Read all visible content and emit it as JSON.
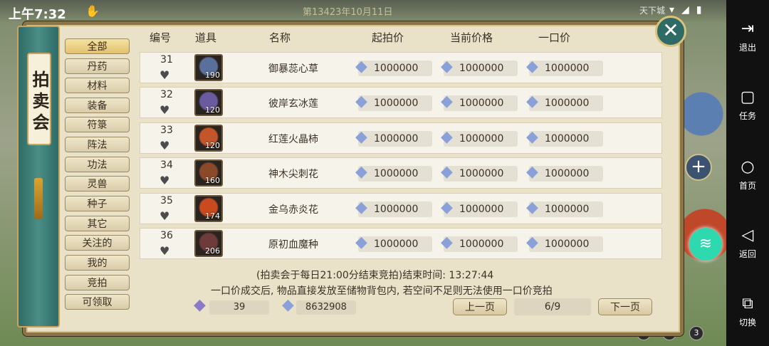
{
  "status": {
    "time": "上午7:32",
    "server_date": "第13423年10月11日",
    "topright": "天下城"
  },
  "sidenav": [
    {
      "icon": "exit-icon",
      "label": "退出"
    },
    {
      "icon": "task-icon",
      "label": "任务"
    },
    {
      "icon": "home-icon",
      "label": "首页"
    },
    {
      "icon": "back-icon",
      "label": "返回"
    },
    {
      "icon": "switch-icon",
      "label": "切换"
    }
  ],
  "panel": {
    "title": "拍卖会"
  },
  "categories": [
    "全部",
    "丹药",
    "材料",
    "装备",
    "符箓",
    "阵法",
    "功法",
    "灵兽",
    "种子",
    "其它",
    "关注的",
    "我的",
    "竞拍",
    "可领取"
  ],
  "active_category": "全部",
  "headers": {
    "id": "编号",
    "item": "道具",
    "name": "名称",
    "start": "起拍价",
    "current": "当前价格",
    "buyout": "一口价"
  },
  "rows": [
    {
      "id": "31",
      "qty": "190",
      "name": "御暴蕊心草",
      "start": "1000000",
      "current": "1000000",
      "buyout": "1000000",
      "color": "#5b6f9c"
    },
    {
      "id": "32",
      "qty": "120",
      "name": "彼岸玄冰莲",
      "start": "1000000",
      "current": "1000000",
      "buyout": "1000000",
      "color": "#6a5aa0"
    },
    {
      "id": "33",
      "qty": "120",
      "name": "红莲火晶柿",
      "start": "1000000",
      "current": "1000000",
      "buyout": "1000000",
      "color": "#c4552a"
    },
    {
      "id": "34",
      "qty": "160",
      "name": "神木尖刺花",
      "start": "1000000",
      "current": "1000000",
      "buyout": "1000000",
      "color": "#8a4a2a"
    },
    {
      "id": "35",
      "qty": "174",
      "name": "金乌赤炎花",
      "start": "1000000",
      "current": "1000000",
      "buyout": "1000000",
      "color": "#c84a1e"
    },
    {
      "id": "36",
      "qty": "206",
      "name": "原初血魔种",
      "start": "1000000",
      "current": "1000000",
      "buyout": "1000000",
      "color": "#6e3a3a"
    }
  ],
  "notice": {
    "line1": "(拍卖会于每日21:00分结束竞拍)结束时间: 13:27:44",
    "line2": "一口价成交后, 物品直接发放至储物背包内, 若空间不足则无法使用一口价竞拍"
  },
  "footer": {
    "scroll_count": "39",
    "stones": "8632908",
    "prev": "上一页",
    "page": "6/9",
    "next": "下一页"
  },
  "page_dots": [
    "1",
    "2",
    "3"
  ]
}
